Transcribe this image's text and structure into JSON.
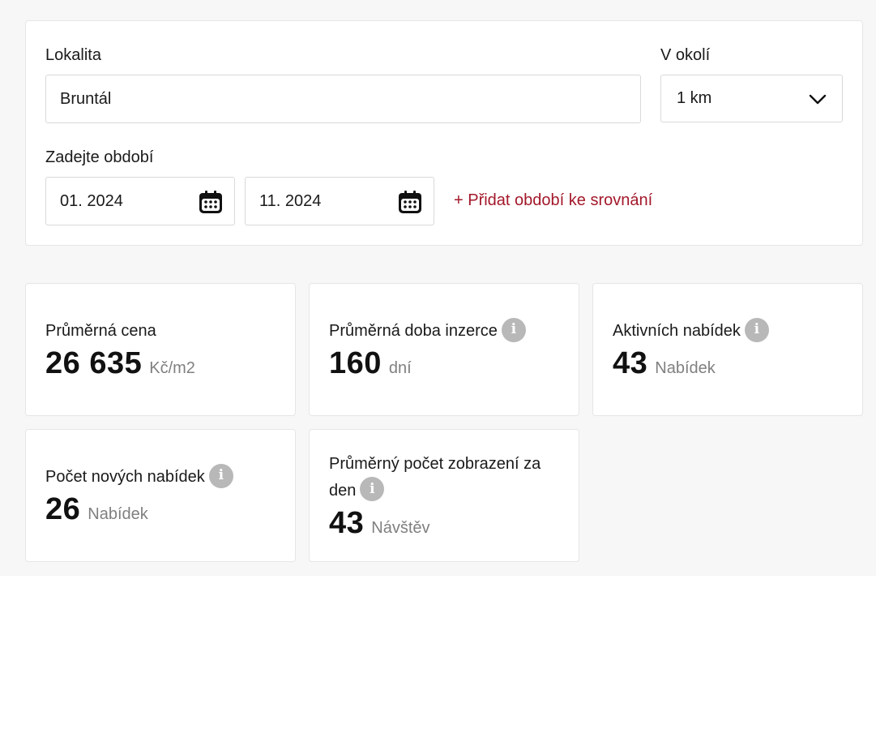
{
  "filters": {
    "location_label": "Lokalita",
    "location_value": "Bruntál",
    "radius_label": "V okolí",
    "radius_value": "1 km",
    "period_label": "Zadejte období",
    "date_from": "01. 2024",
    "date_to": "11. 2024",
    "add_period_link": "+ Přidat období ke srovnání"
  },
  "stats": [
    {
      "title": "Průměrná cena",
      "value": "26 635",
      "unit": "Kč/m2",
      "has_info": false
    },
    {
      "title": "Průměrná doba inzerce",
      "value": "160",
      "unit": "dní",
      "has_info": true
    },
    {
      "title": "Aktivních nabídek",
      "value": "43",
      "unit": "Nabídek",
      "has_info": true
    },
    {
      "title": "Počet nových nabídek",
      "value": "26",
      "unit": "Nabídek",
      "has_info": true
    },
    {
      "title": "Průměrný počet zobrazení za den",
      "value": "43",
      "unit": "Návštěv",
      "has_info": true
    }
  ],
  "icons": {
    "info_glyph": "i",
    "calendar": "calendar-icon",
    "chevron": "chevron-down-icon"
  },
  "colors": {
    "accent_link": "#a3182a",
    "info_icon_bg": "#b8b8b8",
    "page_bg": "#f7f7f7"
  }
}
